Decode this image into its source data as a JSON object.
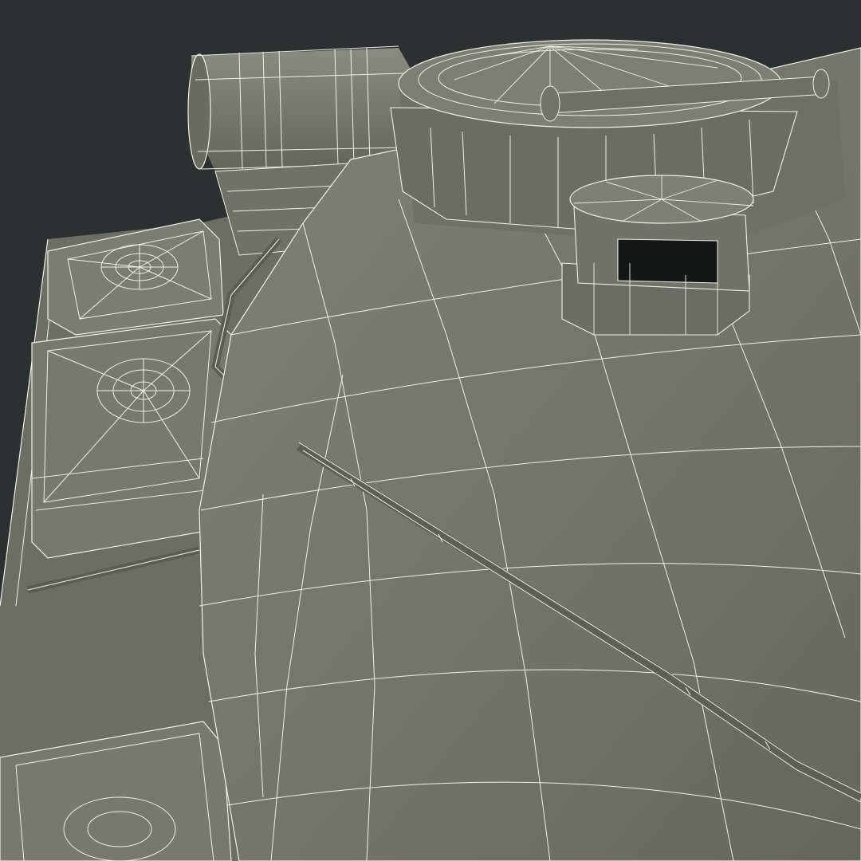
{
  "image": {
    "subject": "wireframe-render-turret",
    "colors": {
      "background": "#2d3031",
      "surface": "#767870",
      "surface_light": "#83857c",
      "surface_dark": "#5e6059",
      "shadow": "#1e2020",
      "wire": "#efefe6",
      "opening": "#151616"
    }
  }
}
